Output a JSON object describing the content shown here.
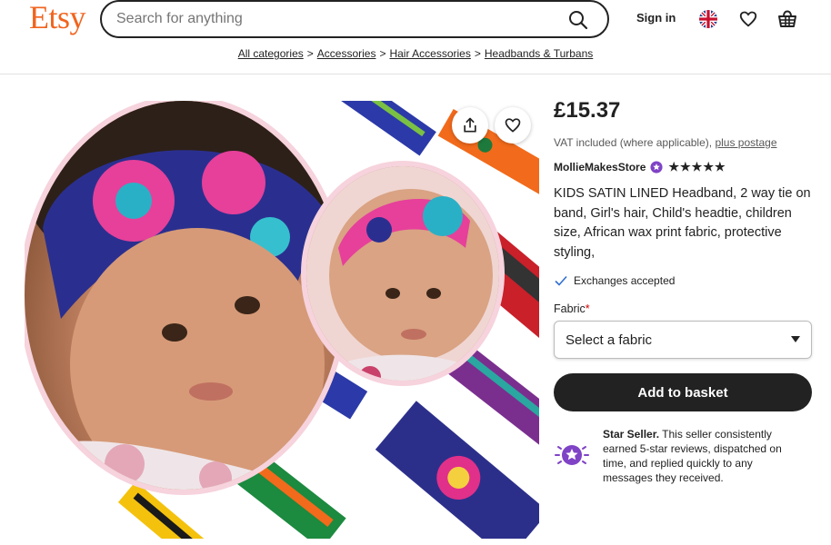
{
  "header": {
    "logo": "Etsy",
    "search_placeholder": "Search for anything",
    "sign_in": "Sign in"
  },
  "breadcrumb": [
    "All categories",
    "Accessories",
    "Hair Accessories",
    "Headbands & Turbans"
  ],
  "breadcrumb_separator": ">",
  "product": {
    "price": "£15.37",
    "vat_text": "VAT included (where applicable),",
    "postage_link": "plus postage",
    "seller": "MollieMakesStore",
    "rating_stars": "★★★★★",
    "title": "KIDS SATIN LINED Headband, 2 way tie on band, Girl's hair, Child's headtie, children size, African wax print fabric, protective styling,",
    "exchanges": "Exchanges accepted",
    "fabric_label": "Fabric",
    "fabric_required": "*",
    "fabric_selected": "Select a fabric",
    "add_to_basket": "Add to basket",
    "star_seller_heading": "Star Seller.",
    "star_seller_text": "This seller consistently earned 5-star reviews, dispatched on time, and replied quickly to any messages they received."
  },
  "colors": {
    "brand": "#f1641e",
    "star_seller_purple": "#7f43c6",
    "button_dark": "#222222",
    "required": "#d10000"
  }
}
